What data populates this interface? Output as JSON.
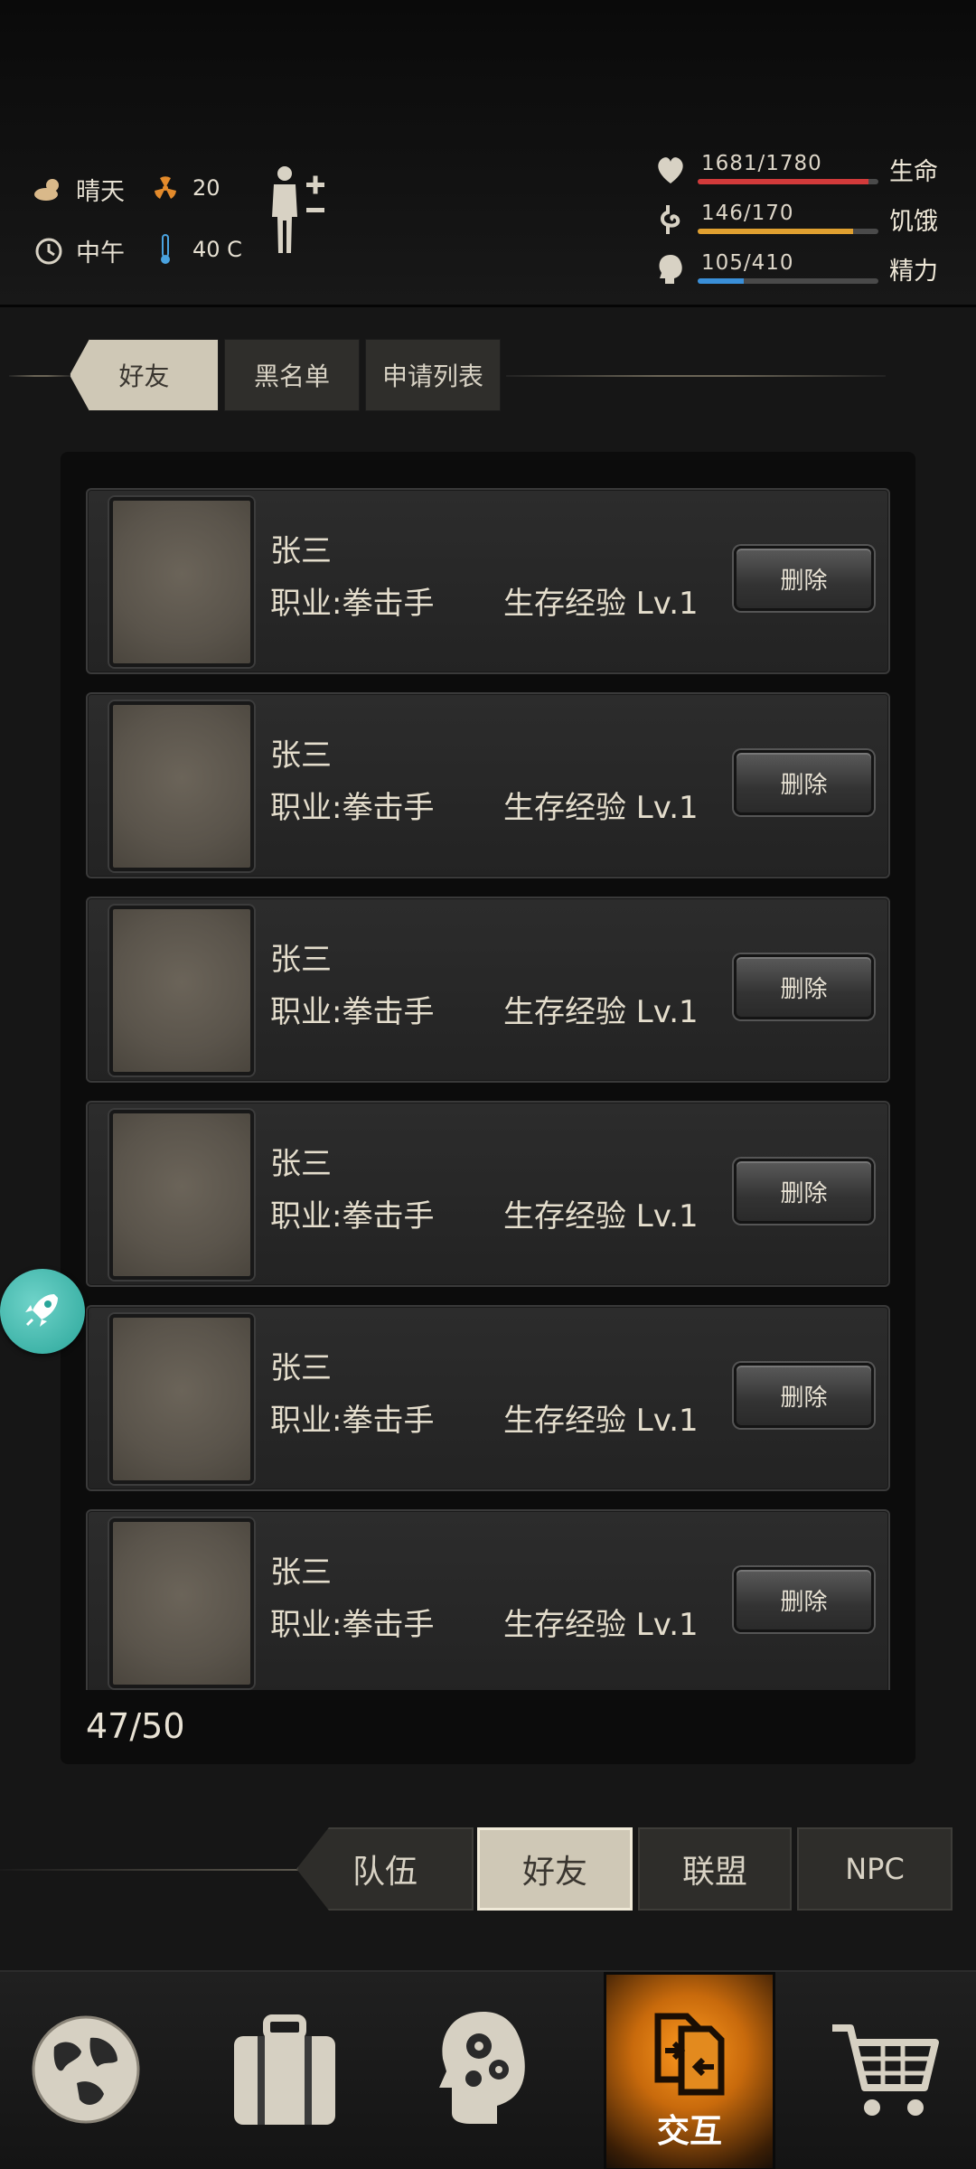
{
  "status": {
    "weather": "晴天",
    "radiation": "20",
    "time": "中午",
    "temperature": "40 C"
  },
  "bars": [
    {
      "value": "1681/1780",
      "label": "生命",
      "fill": 0.944,
      "color": "#d23a3a"
    },
    {
      "value": "146/170",
      "label": "饥饿",
      "fill": 0.859,
      "color": "#e0a030"
    },
    {
      "value": "105/410",
      "label": "精力",
      "fill": 0.256,
      "color": "#3a8fd8"
    }
  ],
  "sub_tabs": [
    "好友",
    "黑名单",
    "申请列表"
  ],
  "friends": [
    {
      "name": "张三",
      "job": "职业:拳击手",
      "exp": "生存经验 Lv.1",
      "action": "删除"
    },
    {
      "name": "张三",
      "job": "职业:拳击手",
      "exp": "生存经验 Lv.1",
      "action": "删除"
    },
    {
      "name": "张三",
      "job": "职业:拳击手",
      "exp": "生存经验 Lv.1",
      "action": "删除"
    },
    {
      "name": "张三",
      "job": "职业:拳击手",
      "exp": "生存经验 Lv.1",
      "action": "删除"
    },
    {
      "name": "张三",
      "job": "职业:拳击手",
      "exp": "生存经验 Lv.1",
      "action": "删除"
    },
    {
      "name": "张三",
      "job": "职业:拳击手",
      "exp": "生存经验 Lv.1",
      "action": "删除"
    }
  ],
  "count": "47/50",
  "category_tabs": [
    "队伍",
    "好友",
    "联盟",
    "NPC"
  ],
  "nav": {
    "items": [
      "world-map-icon",
      "backpack-icon",
      "skills-head-icon",
      "interaction-icon",
      "shop-cart-icon"
    ],
    "active_label": "交互"
  }
}
